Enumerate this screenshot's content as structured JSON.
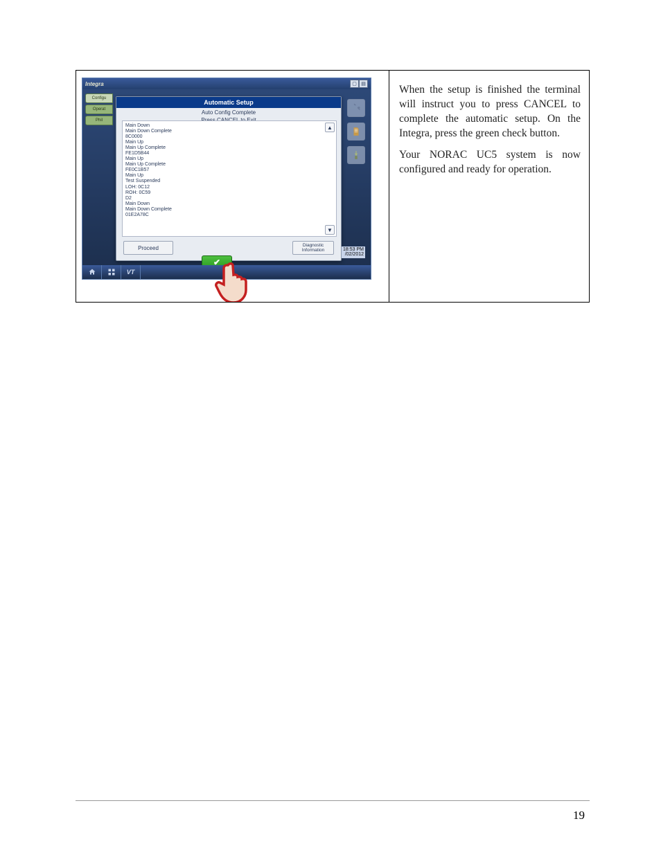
{
  "page_number": "19",
  "instructions": {
    "p1": "When the setup is finished the terminal will instruct you to press CANCEL to complete the automatic setup.  On the Integra, press the green check button.",
    "p2": "Your NORAC UC5 system is now configured and ready for operation."
  },
  "screenshot": {
    "titlebar_brand": "Integra",
    "tabs": {
      "configure": "Configu",
      "operator": "Operat",
      "phil": "Phil"
    },
    "dialog_title": "Automatic Setup",
    "dialog_sub1": "Auto Config Complete",
    "dialog_sub2": "Press CANCEL to Exit",
    "log": [
      "Main Down",
      "Main Down Complete",
      "8C0000",
      "Main Up",
      "Main Up Complete",
      "FE1D5B44",
      "Main Up",
      "Main Up Complete",
      "FE0C1B57",
      "Main Up",
      "Test Suspended",
      "LOH: 0C12",
      "ROH: 0C59",
      "D2",
      "Main Down",
      "Main Down Complete",
      "01E2A78C"
    ],
    "proceed_label": "Proceed",
    "diag_label": "Diagnostic Information",
    "time": "18:53 PM",
    "date": "/02/2012",
    "bottom_vt": "VT"
  }
}
